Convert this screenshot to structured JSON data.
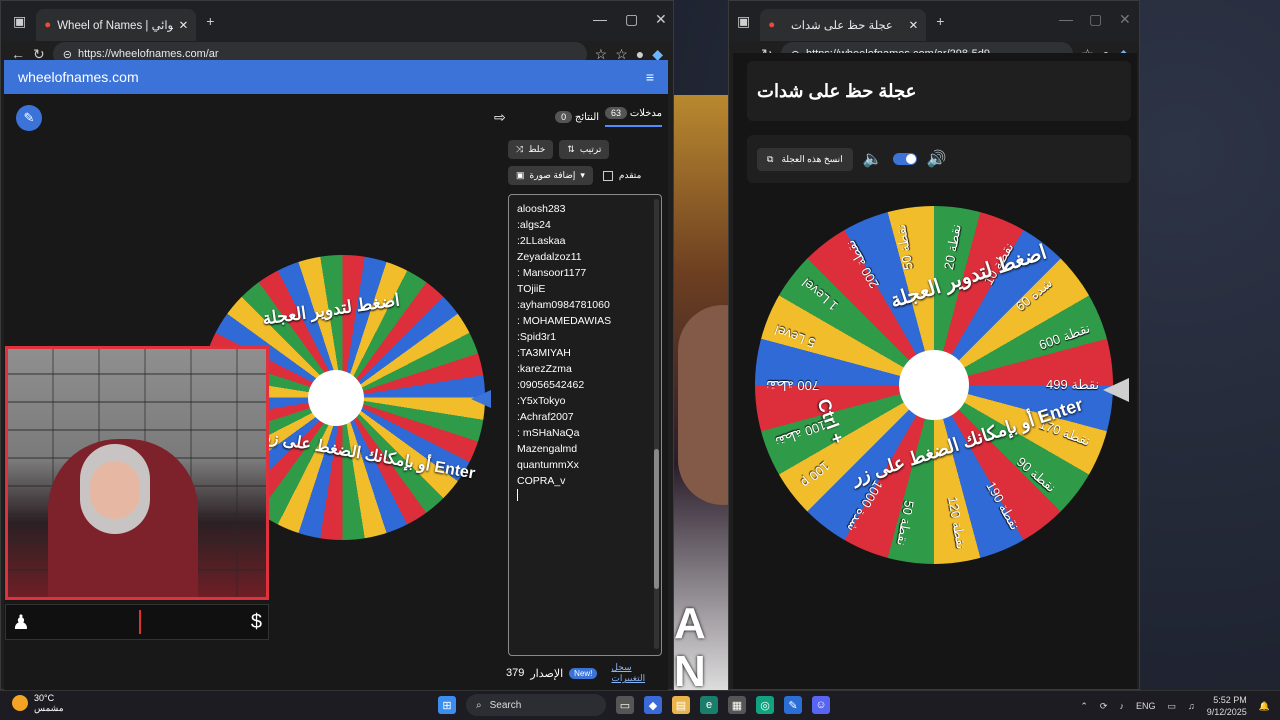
{
  "left_browser": {
    "tab_title": "Wheel of Names | الاسم العشوائي",
    "url": "https://wheelofnames.com/ar",
    "site_name": "wheelofnames.com",
    "tabs": {
      "entries_label": "مدخلات",
      "entries_count": "63",
      "results_label": "النتائج",
      "results_count": "0"
    },
    "buttons": {
      "shuffle": "خلط",
      "sort": "ترتيب",
      "add_image": "إضافة صورة",
      "advanced": "متقدم"
    },
    "wheel_text_top": "اضغط لتدوير العجلة",
    "wheel_text_bottom": "أو بإمكانك الضغط على زر Enter",
    "entries": [
      "aloosh283",
      ":algs24",
      ":2LLaskaa",
      "Zeyadalzoz11",
      ": Mansoor1177",
      "TOjiiE",
      ":ayham0984781060",
      ": MOHAMEDAWIAS",
      ":Spid3r1",
      ":TA3MIYAH",
      ":karezZzma",
      ":09056542462",
      ":Y5xTokyo",
      ":Achraf2007",
      ": mSHaNaQa",
      "Mazengalmd",
      "quantummXx",
      "COPRA_v"
    ],
    "footer": {
      "version_label": "الإصدار",
      "version": "379",
      "new_badge": "New!",
      "changelog": "سجل التغييرات"
    }
  },
  "right_browser": {
    "tab_title": "عجلة حظ على شدات",
    "url": "https://wheelofnames.com/ar/298-5d9",
    "wheel_title": "عجلة حظ على شدات",
    "copy_button": "انسخ هذه العجلة",
    "wheel_text_top": "اضغط لتدوير العجلة",
    "wheel_text_bottom": "أو بإمكانك الضغط على زر Enter",
    "wheel_text_ctrl": "Ctrl +",
    "segments": [
      "نقطة 10",
      "شدة 60",
      "نقطة 600",
      "نقطة 499",
      "نقطة 170",
      "نقطة 90",
      "نقطة 190",
      "نقطة 120",
      "نقطة 50",
      "1000 شدة",
      "100 p",
      "100 نقطة",
      "700 نقطة",
      "5 Level",
      "1 Level",
      "200 نقطة",
      "نقطة 50",
      "نقطة 20"
    ]
  },
  "taskbar": {
    "temp": "30°C",
    "weather_desc": "مشمس",
    "search": "Search",
    "lang": "ENG",
    "time": "5:52 PM",
    "date": "9/12/2025"
  }
}
